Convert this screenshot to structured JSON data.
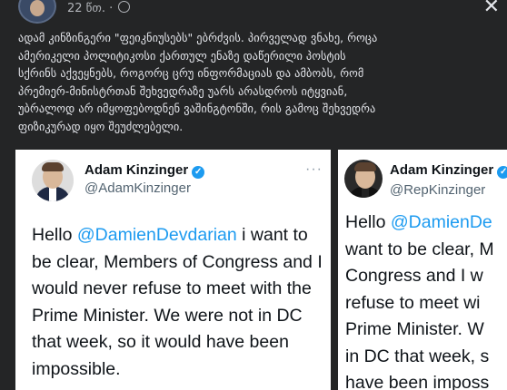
{
  "post": {
    "time": "22 წთ.",
    "separator": "·",
    "text_lines": [
      "ადამ კინზინგერი \"ფეიკნიუსებს\" ებრძვის. პირველად ვნახე, როცა",
      "ამერიკელი პოლიტიკოსი ქართულ ენაზე დაწერილი პოსტის",
      "სქრინს აქვეყნებს, როგორც ცრუ ინფორმაციას და ამბობს, რომ",
      "პრემიერ-მინისტრთან შეხვედრაზე უარს არასდროს იტყვიან,",
      "უბრალოდ არ იმყოფებოდნენ ვაშინგტონში, რის გამოც შეხვედრა",
      "ფიზიკურად იყო შეუძლებელი."
    ]
  },
  "tweet_left": {
    "name": "Adam Kinzinger",
    "handle": "@AdamKinzinger",
    "more": "···",
    "lines": [
      {
        "pre": "Hello ",
        "mention": "@DamienDevdarian",
        "post": " i want to"
      },
      {
        "pre": "be clear, Members of Congress and I",
        "mention": "",
        "post": ""
      },
      {
        "pre": "would never refuse to meet with the",
        "mention": "",
        "post": ""
      },
      {
        "pre": "Prime Minister.  We were not in DC",
        "mention": "",
        "post": ""
      },
      {
        "pre": "that week, so it would have been",
        "mention": "",
        "post": ""
      },
      {
        "pre": "impossible.",
        "mention": "",
        "post": ""
      }
    ]
  },
  "tweet_right": {
    "name": "Adam Kinzinger",
    "handle": "@RepKinzinger",
    "lines": [
      {
        "pre": "Hello ",
        "mention": "@DamienDe",
        "post": ""
      },
      {
        "pre": "want to be clear, M",
        "mention": "",
        "post": ""
      },
      {
        "pre": "Congress and I w",
        "mention": "",
        "post": ""
      },
      {
        "pre": "refuse to meet wi",
        "mention": "",
        "post": ""
      },
      {
        "pre": "Prime Minister.  W",
        "mention": "",
        "post": ""
      },
      {
        "pre": "in DC that week, s",
        "mention": "",
        "post": ""
      },
      {
        "pre": "have been imposs",
        "mention": "",
        "post": ""
      }
    ]
  },
  "icons": {
    "close": "close-icon",
    "globe": "globe-icon",
    "verified": "verified-icon",
    "more": "more-icon"
  },
  "colors": {
    "background": "#242526",
    "text": "#e4e6eb",
    "mention": "#1d9bf0",
    "verified": "#1d9bf0"
  }
}
